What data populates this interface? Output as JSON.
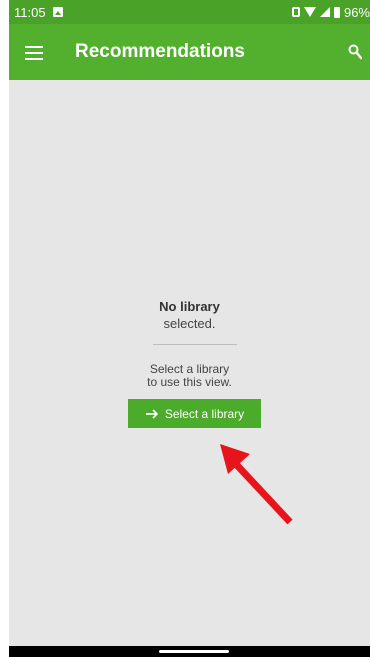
{
  "status_bar": {
    "time": "11:05",
    "battery": "96%"
  },
  "app_bar": {
    "title": "Recommendations"
  },
  "empty_state": {
    "title": "No library",
    "subtitle": "selected.",
    "hint_line1": "Select a library",
    "hint_line2": "to use this view.",
    "button_label": "Select a library"
  },
  "icons": {
    "menu": "menu-icon",
    "search": "search-icon",
    "arrow": "arrow-right-icon"
  },
  "colors": {
    "status_bar": "#4aa228",
    "app_bar": "#52b02e",
    "button": "#4bab2a",
    "annotation": "#e8141b"
  }
}
